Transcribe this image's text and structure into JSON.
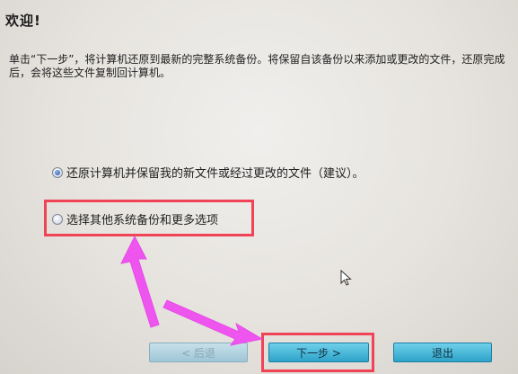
{
  "heading": "欢迎!",
  "intro": "单击“下一步”，将计算机还原到最新的完整系统备份。将保留自该备份以来添加或更改的文件，还原完成后，会将这些文件复制回计算机。",
  "options": [
    {
      "label": "还原计算机并保留我的新文件或经过更改的文件（建议）。",
      "selected": true
    },
    {
      "label": "选择其他系统备份和更多选项",
      "selected": false
    }
  ],
  "buttons": {
    "back": "< 后退",
    "next": "下一步 >",
    "exit": "退出"
  },
  "colors": {
    "highlight": "#f04356",
    "annotation_arrow": "#ee55ee",
    "button": "#2da3c9"
  },
  "icons": {
    "cursor": "mouse-pointer-icon"
  }
}
